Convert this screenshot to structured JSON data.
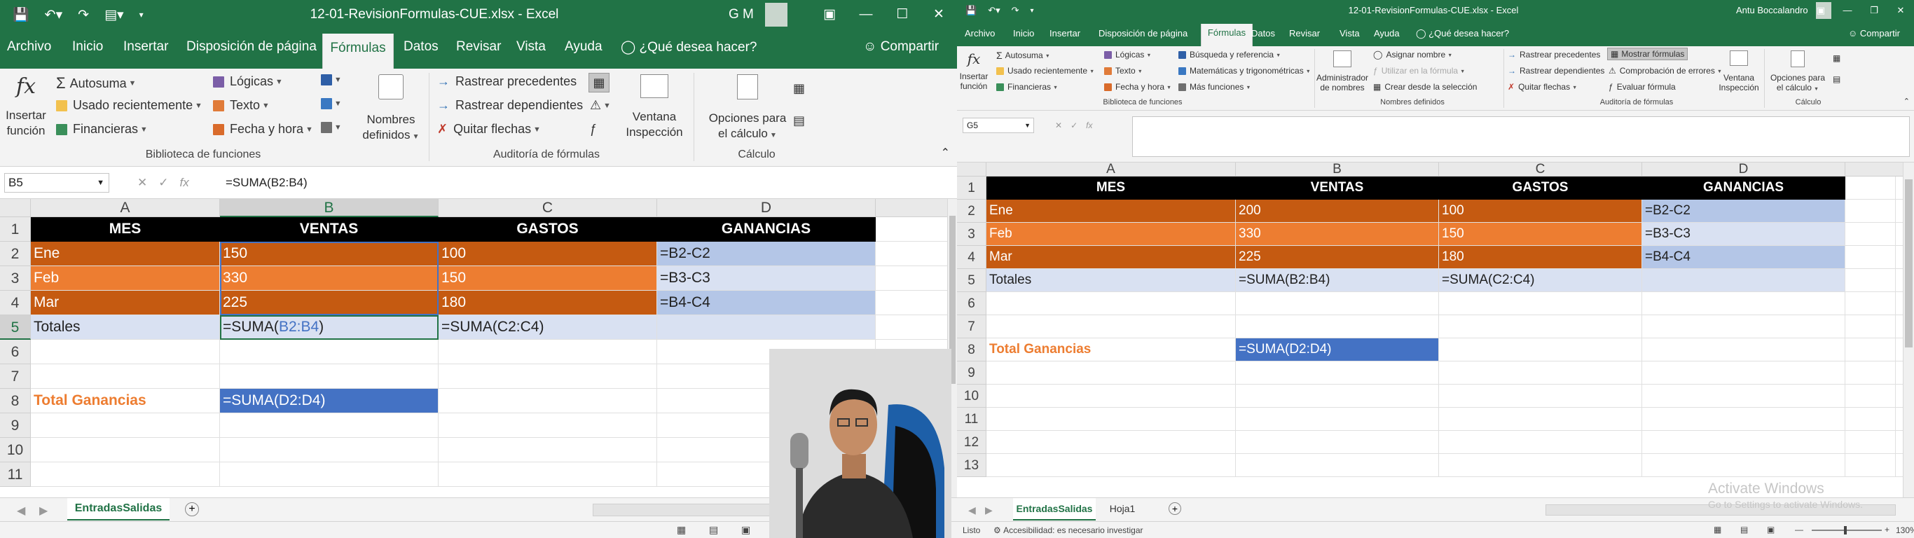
{
  "left": {
    "title": "12-01-RevisionFormulas-CUE.xlsx  -  Excel",
    "user_initials": "G M",
    "tabs": [
      "Archivo",
      "Inicio",
      "Insertar",
      "Disposición de página",
      "Fórmulas",
      "Datos",
      "Revisar",
      "Vista",
      "Ayuda"
    ],
    "active_tab": "Fórmulas",
    "tellme": "¿Qué desea hacer?",
    "share": "Compartir",
    "ribbon": {
      "insert_function": [
        "Insertar",
        "función"
      ],
      "autosum": "Autosuma",
      "recent": "Usado recientemente",
      "financial": "Financieras",
      "logical": "Lógicas",
      "text": "Texto",
      "datetime": "Fecha y hora",
      "defined_names": [
        "Nombres",
        "definidos"
      ],
      "trace_precedents": "Rastrear precedentes",
      "trace_dependents": "Rastrear dependientes",
      "remove_arrows": "Quitar flechas",
      "watch": [
        "Ventana",
        "Inspección"
      ],
      "calc_options": [
        "Opciones para",
        "el cálculo"
      ],
      "group_library": "Biblioteca de funciones",
      "group_audit": "Auditoría de fórmulas",
      "group_calc": "Cálculo"
    },
    "namebox": "B5",
    "formula": "=SUMA(B2:B4)",
    "columns": [
      "A",
      "B",
      "C",
      "D"
    ],
    "rows": [
      "1",
      "2",
      "3",
      "4",
      "5",
      "6",
      "7",
      "8",
      "9",
      "10",
      "11"
    ],
    "cells": {
      "A1": "MES",
      "B1": "VENTAS",
      "C1": "GASTOS",
      "D1": "GANANCIAS",
      "A2": "Ene",
      "B2": "150",
      "C2": "100",
      "D2": "=B2-C2",
      "A3": "Feb",
      "B3": "330",
      "C3": "150",
      "D3": "=B3-C3",
      "A4": "Mar",
      "B4": "225",
      "C4": "180",
      "D4": "=B4-C4",
      "A5": "Totales",
      "B5_pre": "=SUMA(",
      "B5_ref": "B2:B4",
      "B5_post": ")",
      "C5": "=SUMA(C2:C4)",
      "A8": "Total Ganancias",
      "B8": "=SUMA(D2:D4)"
    },
    "sheet_tabs": [
      "EntradasSalidas"
    ],
    "colors": {
      "accent": "#217346",
      "dark_orange": "#c55a11",
      "orange": "#ed7d31",
      "light_blue": "#b4c6e7",
      "pale_blue": "#d9e1f2",
      "blue": "#4472c4"
    }
  },
  "right": {
    "title": "12-01-RevisionFormulas-CUE.xlsx  -  Excel",
    "user": "Antu Boccalandro",
    "tabs": [
      "Archivo",
      "Inicio",
      "Insertar",
      "Disposición de página",
      "Fórmulas",
      "Datos",
      "Revisar",
      "Vista",
      "Ayuda"
    ],
    "active_tab": "Fórmulas",
    "tellme": "¿Qué desea hacer?",
    "share": "Compartir",
    "ribbon": {
      "insert_function": [
        "Insertar",
        "función"
      ],
      "autosum": "Autosuma",
      "recent": "Usado recientemente",
      "financial": "Financieras",
      "logical": "Lógicas",
      "text": "Texto",
      "datetime": "Fecha y hora",
      "lookup": "Búsqueda y referencia",
      "math": "Matemáticas y trigonométricas",
      "more": "Más funciones",
      "name_manager": [
        "Administrador",
        "de nombres"
      ],
      "assign_name": "Asignar nombre",
      "use_in_formula": "Utilizar en la fórmula",
      "create_from_sel": "Crear desde la selección",
      "trace_precedents": "Rastrear precedentes",
      "trace_dependents": "Rastrear dependientes",
      "remove_arrows": "Quitar flechas",
      "show_formulas": "Mostrar fórmulas",
      "error_check": "Comprobación de errores",
      "evaluate": "Evaluar fórmula",
      "watch": [
        "Ventana",
        "Inspección"
      ],
      "calc_options": [
        "Opciones para",
        "el cálculo"
      ],
      "group_library": "Biblioteca de funciones",
      "group_names": "Nombres definidos",
      "group_audit": "Auditoría de fórmulas",
      "group_calc": "Cálculo"
    },
    "namebox": "G5",
    "formula": "",
    "columns": [
      "A",
      "B",
      "C",
      "D"
    ],
    "rows": [
      "1",
      "2",
      "3",
      "4",
      "5",
      "6",
      "7",
      "8",
      "9",
      "10",
      "11",
      "12",
      "13"
    ],
    "cells": {
      "A1": "MES",
      "B1": "VENTAS",
      "C1": "GASTOS",
      "D1": "GANANCIAS",
      "A2": "Ene",
      "B2": "200",
      "C2": "100",
      "D2": "=B2-C2",
      "A3": "Feb",
      "B3": "330",
      "C3": "150",
      "D3": "=B3-C3",
      "A4": "Mar",
      "B4": "225",
      "C4": "180",
      "D4": "=B4-C4",
      "A5": "Totales",
      "B5": "=SUMA(B2:B4)",
      "C5": "=SUMA(C2:C4)",
      "A8": "Total Ganancias",
      "B8": "=SUMA(D2:D4)"
    },
    "sheet_tabs": [
      "EntradasSalidas",
      "Hoja1"
    ],
    "status": [
      "Listo",
      "Accesibilidad: es necesario investigar"
    ],
    "zoom": "130%",
    "watermark": [
      "Activate Windows",
      "Go to Settings to activate Windows."
    ]
  }
}
